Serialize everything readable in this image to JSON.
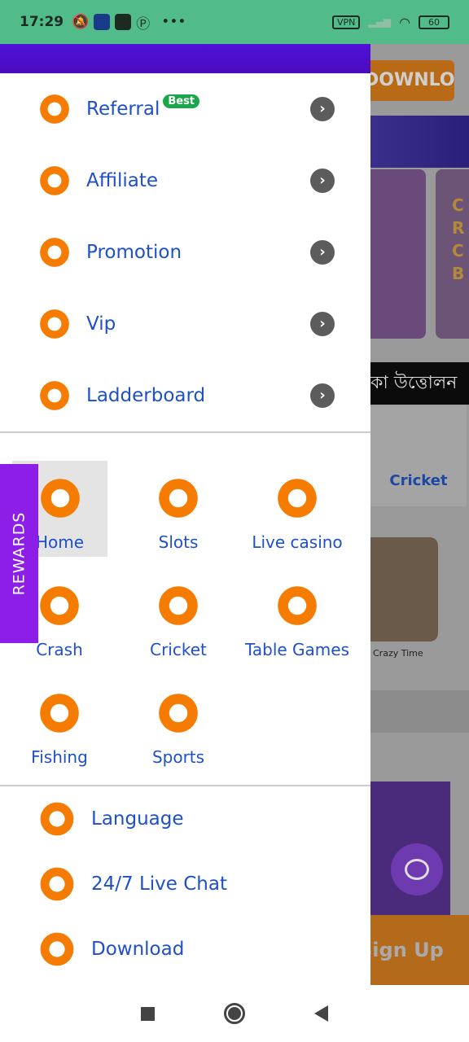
{
  "status_bar": {
    "time": "17:29",
    "vpn": "VPN",
    "battery": "60"
  },
  "background": {
    "download": "DOWNLOAD",
    "banner_text": "CRCB",
    "ticker": "কা উত্তোলন",
    "category": "Cricket",
    "game": "Crazy Time",
    "signup": "Sign Up"
  },
  "menu": [
    {
      "label": "Referral",
      "badge": "Best",
      "icon": "referral-icon"
    },
    {
      "label": "Affiliate",
      "icon": "affiliate-icon"
    },
    {
      "label": "Promotion",
      "icon": "promotion-icon"
    },
    {
      "label": "Vip",
      "icon": "crown-icon"
    },
    {
      "label": "Ladderboard",
      "icon": "trophy-icon"
    }
  ],
  "games": [
    {
      "label": "Home",
      "selected": true
    },
    {
      "label": "Slots"
    },
    {
      "label": "Live casino"
    },
    {
      "label": "Crash"
    },
    {
      "label": "Cricket"
    },
    {
      "label": "Table Games"
    },
    {
      "label": "Fishing"
    },
    {
      "label": "Sports"
    }
  ],
  "bottom": [
    {
      "label": "Language"
    },
    {
      "label": "24/7 Live Chat"
    },
    {
      "label": "Download"
    }
  ],
  "rewards": "REWARDS",
  "colors": {
    "accent": "#f57c00",
    "text": "#1e50c8",
    "header": "#4a0cbe",
    "status": "#52bb8a",
    "rewards": "#8d1ee8"
  }
}
